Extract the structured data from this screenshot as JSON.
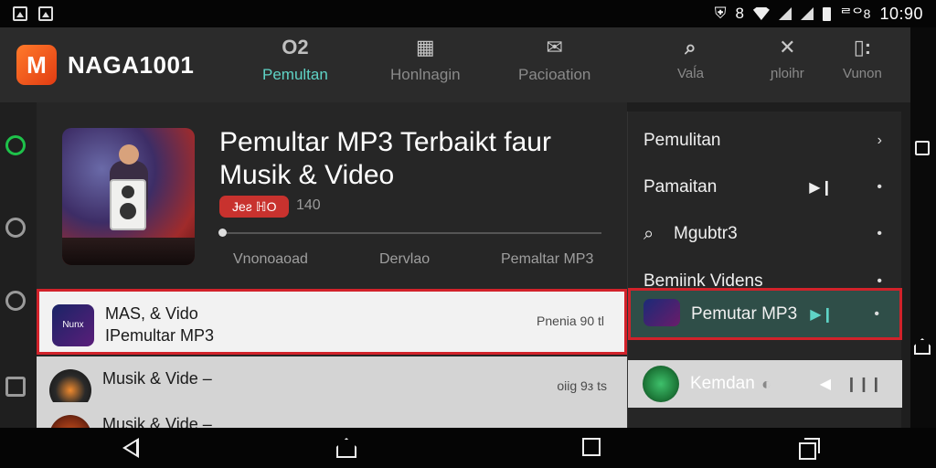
{
  "status_bar": {
    "time": "10:90",
    "extra": "ᄅᄋ8",
    "signal_digit": "8"
  },
  "app": {
    "logo_text": "M",
    "name": "NAGA1001"
  },
  "nav_tabs": [
    {
      "icon": "O2",
      "label": "Pemultan"
    },
    {
      "icon": "▦",
      "label": "Honlnagin"
    },
    {
      "icon": "✉",
      "label": "Pacioation"
    },
    {
      "icon": "⌕",
      "label": "Vaĺa"
    },
    {
      "icon": "✕",
      "label": "ɲloihr"
    },
    {
      "icon": "▯:",
      "label": "Vunon"
    }
  ],
  "hero": {
    "title": "Pemultar MP3 Terbaikt faur Musik & Video",
    "badge": "Ɉeƨ ℍO",
    "count": "140",
    "progress": 0.0,
    "meta": [
      "Vnonoaoad",
      "Dervlao",
      "Pemaltar MP3"
    ]
  },
  "tracks": [
    {
      "line1": "MAS, & Vido",
      "line2": "IPemultar MP3",
      "right": "Pnenia 90 tl",
      "thumb_text": "Nunx"
    },
    {
      "line1": "Musik & Vide –",
      "line2": "",
      "right": "oiig 9з ts"
    },
    {
      "line1": "Musik & Vide –",
      "line2": "",
      "right": ""
    }
  ],
  "menu": {
    "items": [
      {
        "label": "Pemulitan",
        "right": "›"
      },
      {
        "label": "Pamaitan",
        "right": "•",
        "play": "▶❙"
      },
      {
        "label": "Mgubtr3",
        "right": "•"
      },
      {
        "label": "Bemiink Videns",
        "right": "•"
      },
      {
        "label": "Pemutar MP3",
        "right": "•",
        "play": "▶❙"
      },
      {
        "label": "Kemdan",
        "right": "❙❙❙",
        "play": "◀"
      }
    ]
  },
  "colors": {
    "accent": "#5fd3c6",
    "highlight": "#d2222a",
    "brand": "#ff6a25"
  }
}
